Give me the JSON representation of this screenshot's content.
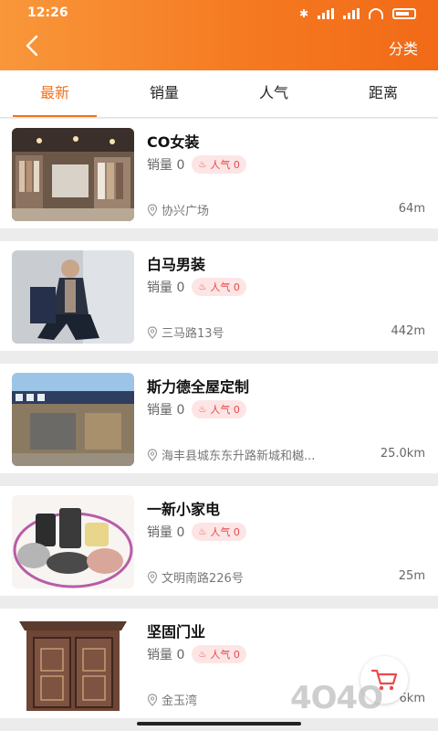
{
  "status_bar": {
    "time": "12:26"
  },
  "header": {
    "category_label": "分类"
  },
  "tabs": [
    {
      "label": "最新",
      "active": true
    },
    {
      "label": "销量",
      "active": false
    },
    {
      "label": "人气",
      "active": false
    },
    {
      "label": "距离",
      "active": false
    }
  ],
  "stores": [
    {
      "name": "CO女装",
      "sales_label": "销量 0",
      "popularity_label": "人气 0",
      "address": "协兴广场",
      "distance": "64m"
    },
    {
      "name": "白马男装",
      "sales_label": "销量 0",
      "popularity_label": "人气 0",
      "address": "三马路13号",
      "distance": "442m"
    },
    {
      "name": "斯力德全屋定制",
      "sales_label": "销量 0",
      "popularity_label": "人气 0",
      "address": "海丰县城东东升路新城和樾...",
      "distance": "25.0km"
    },
    {
      "name": "一新小家电",
      "sales_label": "销量 0",
      "popularity_label": "人气 0",
      "address": "文明南路226号",
      "distance": "25m"
    },
    {
      "name": "坚固门业",
      "sales_label": "销量 0",
      "popularity_label": "人气 0",
      "address": "金玉湾",
      "distance": "6km"
    }
  ],
  "watermark": "4O4O",
  "colors": {
    "accent": "#f2711c",
    "header_start": "#f9973a",
    "header_end": "#f26a17",
    "badge_bg": "#fde5e5",
    "badge_text": "#e84a4a"
  },
  "icons": {
    "back": "chevron-left-icon",
    "cart": "cart-icon",
    "location": "location-pin-icon",
    "popularity": "flame-icon"
  }
}
